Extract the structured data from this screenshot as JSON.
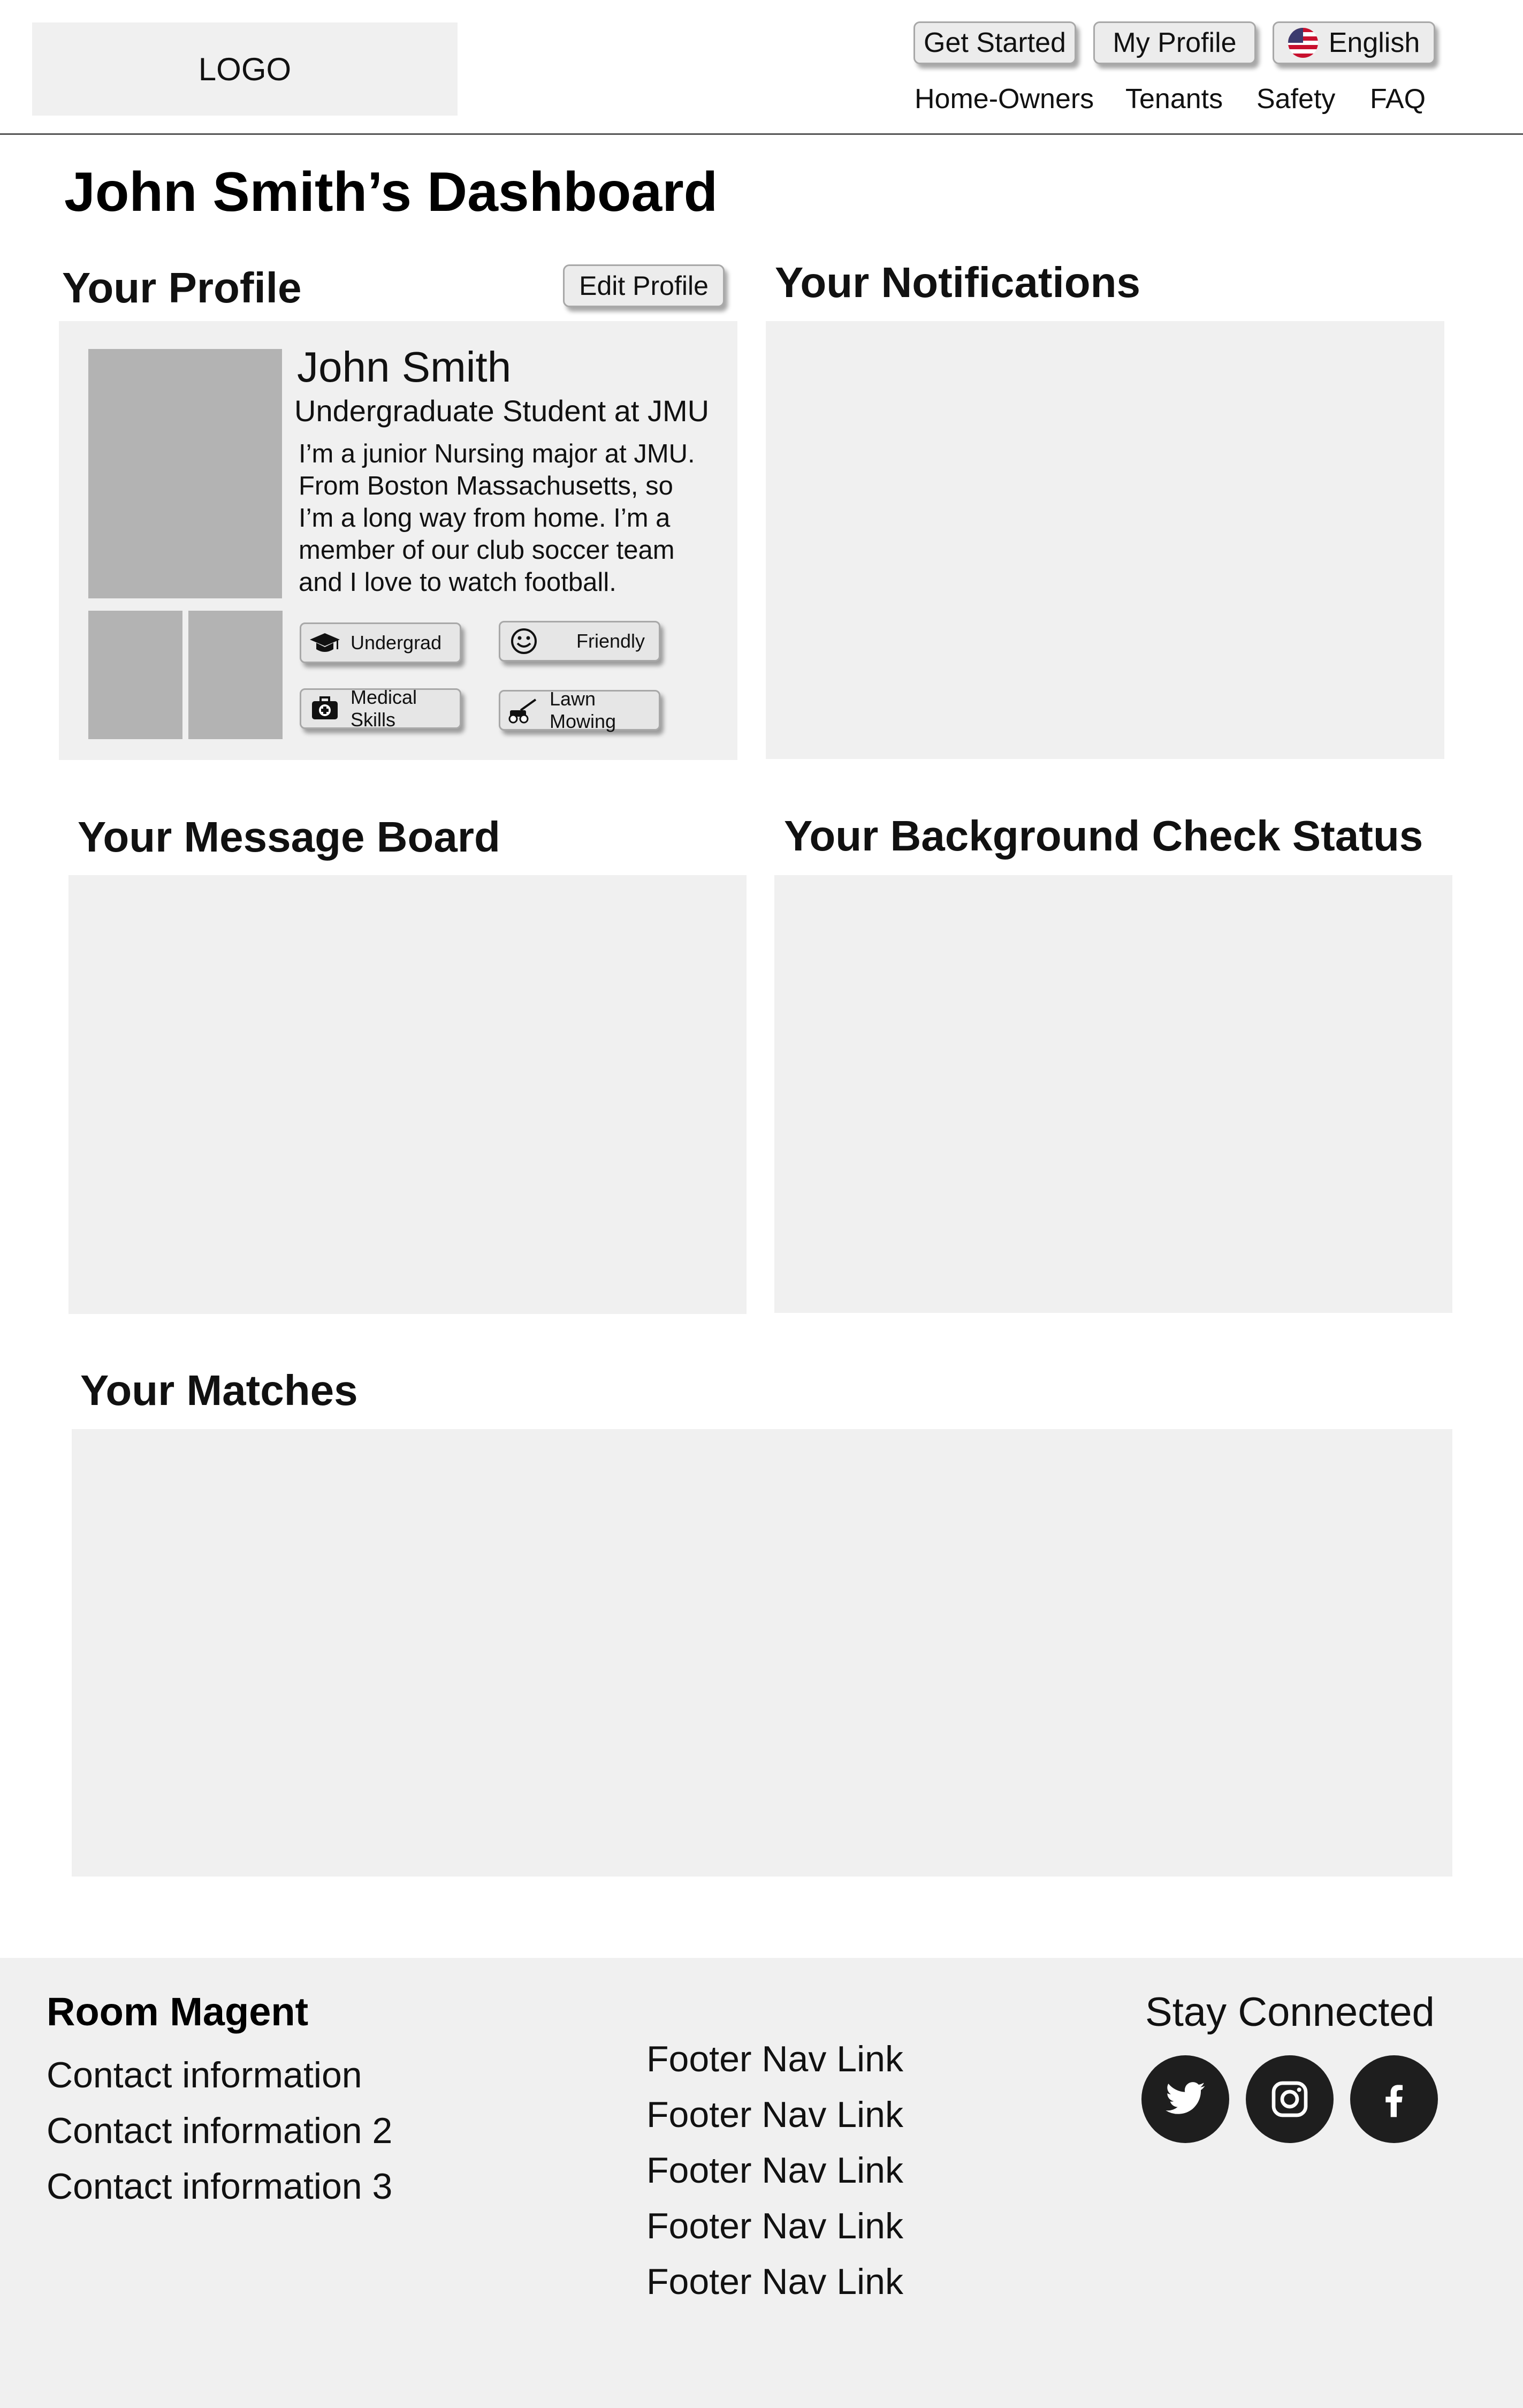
{
  "header": {
    "logo": "LOGO",
    "buttons": {
      "get_started": "Get Started",
      "my_profile": "My Profile",
      "language": "English"
    },
    "language_icon": "us-flag-icon",
    "nav": [
      "Home-Owners",
      "Tenants",
      "Safety",
      "FAQ"
    ]
  },
  "dashboard": {
    "title": "John Smith’s Dashboard",
    "profile": {
      "heading": "Your Profile",
      "edit_label": "Edit Profile",
      "name": "John Smith",
      "subtitle": "Undergraduate Student at JMU",
      "bio": [
        "I’m a junior Nursing major at JMU.",
        "From Boston Massachusetts, so",
        "I’m a long way from home. I’m a",
        "member of our club soccer team",
        "and I love to watch football."
      ],
      "tags": [
        {
          "label": "Undergrad",
          "icon": "graduation-cap-icon"
        },
        {
          "label": "Friendly",
          "icon": "smiley-face-icon"
        },
        {
          "label": "Medical Skills",
          "icon": "medical-kit-icon"
        },
        {
          "label": "Lawn Mowing",
          "icon": "lawn-mower-icon"
        }
      ]
    },
    "notifications": {
      "heading": "Your Notifications"
    },
    "message_board": {
      "heading": "Your Message Board"
    },
    "background_check": {
      "heading": "Your Background Check Status"
    },
    "matches": {
      "heading": "Your Matches"
    }
  },
  "footer": {
    "brand": "Room Magent",
    "contacts": [
      "Contact information",
      "Contact information 2",
      "Contact information 3"
    ],
    "nav_links": [
      "Footer Nav Link",
      "Footer Nav Link",
      "Footer Nav Link",
      "Footer Nav Link",
      "Footer Nav Link"
    ],
    "stay_connected": "Stay Connected",
    "social": [
      "twitter-icon",
      "instagram-icon",
      "facebook-icon"
    ]
  },
  "colors": {
    "panel": "#f0f0f0",
    "placeholder_image": "#b3b3b3",
    "button": "#ececec",
    "social_circle": "#1e1e1e"
  }
}
